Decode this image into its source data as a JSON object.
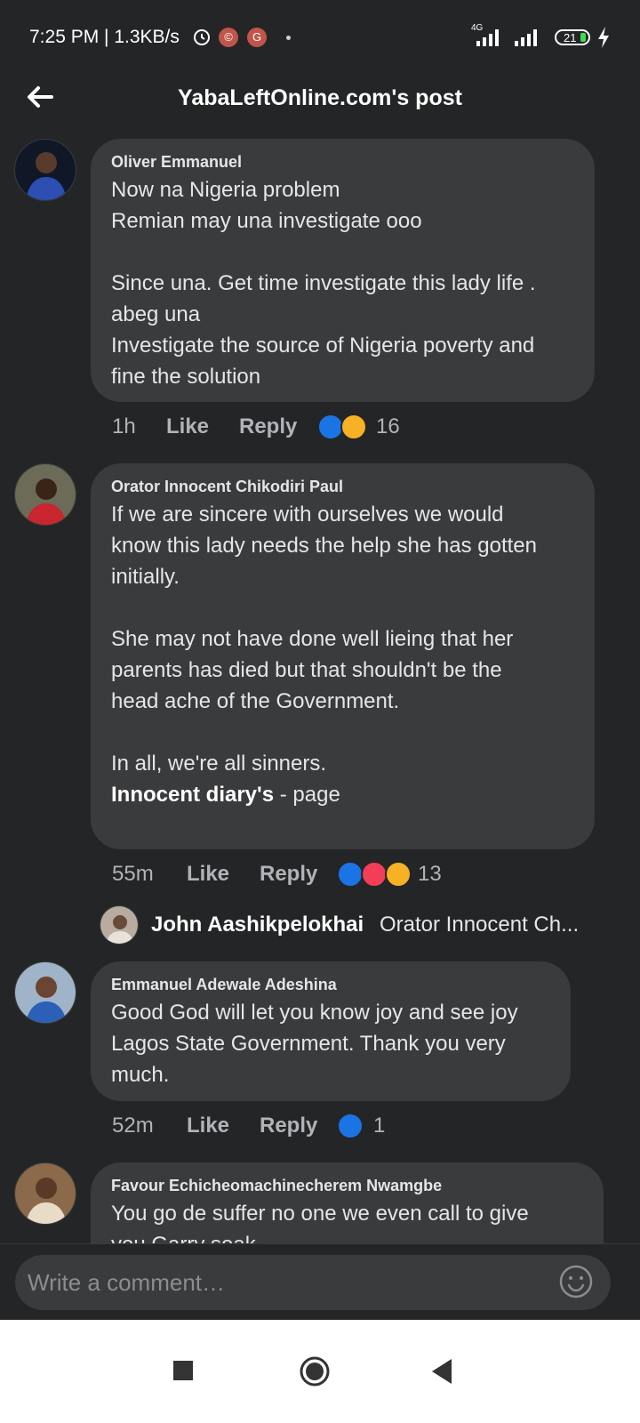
{
  "status_bar": {
    "time": "7:25 PM | 1.3KB/s",
    "badge1": "©",
    "badge2": "G",
    "network": "4G",
    "battery": "21"
  },
  "header": {
    "title": "YabaLeftOnline.com's post"
  },
  "comments": [
    {
      "author": "Oliver Emmanuel",
      "body": "Now na Nigeria problem\nRemian may una investigate ooo\n\nSince una. Get time investigate this lady life .\nabeg una\nInvestigate the source of Nigeria poverty and\nfine the solution",
      "time": "1h",
      "like": "Like",
      "reply": "Reply",
      "reaction_count": "16"
    },
    {
      "author": "Orator Innocent Chikodiri Paul",
      "body": "If we are sincere with ourselves we would\nknow this lady needs the help she has gotten\ninitially.\n\nShe may not have done well lieing that her\nparents has died but that shouldn't be the\nhead ache of the Government.\n\nIn all, we're all sinners.\n",
      "page_name": "Innocent diary's",
      "page_suffix": " - page",
      "time": "55m",
      "like": "Like",
      "reply": "Reply",
      "reaction_count": "13"
    },
    {
      "author": "Emmanuel Adewale Adeshina",
      "body": "Good God will let you know joy and see joy\nLagos State Government. Thank you very\nmuch.",
      "time": "52m",
      "like": "Like",
      "reply": "Reply",
      "reaction_count": "1"
    },
    {
      "author": "Favour Echicheomachinecherem Nwamgbe",
      "body": "You go de suffer no one we even call to give\nyou Garry soak"
    }
  ],
  "reply_preview": {
    "name": "John Aashikpelokhai",
    "text": "Orator Innocent Ch..."
  },
  "composer": {
    "placeholder": "Write a comment…"
  },
  "colors": {
    "background": "#242526",
    "bubble": "#3a3b3c",
    "like": "#1b74e4",
    "love": "#f33e58",
    "haha": "#f7b125"
  }
}
